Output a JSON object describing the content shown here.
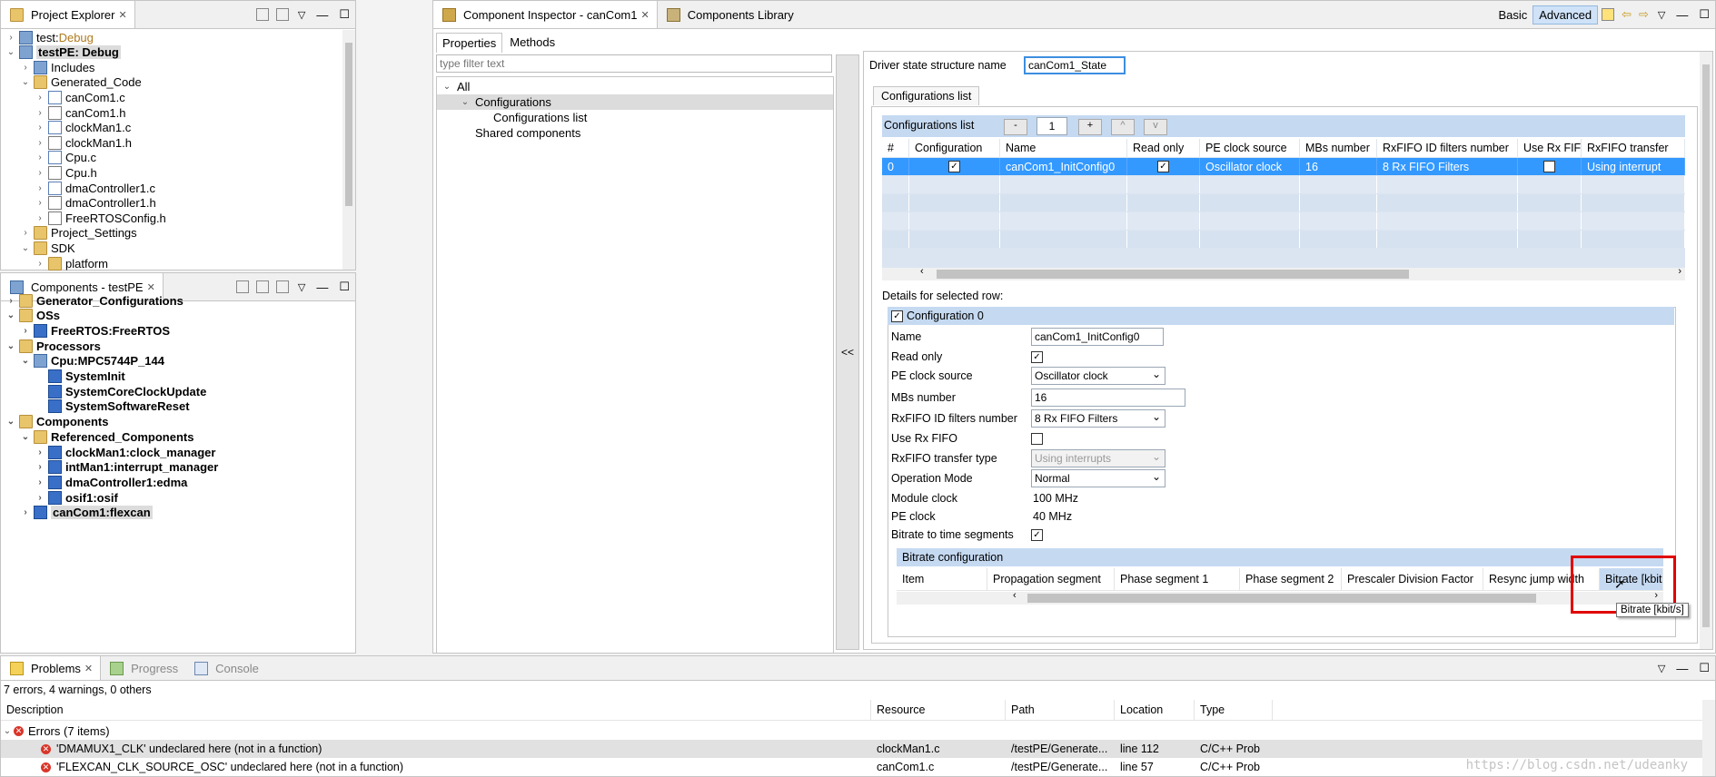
{
  "project_explorer": {
    "title": "Project Explorer",
    "items": [
      {
        "label": "test: ",
        "label2": "Debug",
        "indent": 0,
        "tw": "›",
        "icon": "project-icon",
        "bold": false
      },
      {
        "label": "testPE: Debug",
        "label2": "",
        "indent": 0,
        "tw": "⌄",
        "icon": "project-icon",
        "bold": true
      },
      {
        "label": "Includes",
        "label2": "",
        "indent": 1,
        "tw": "›",
        "icon": "includes-icon",
        "bold": false
      },
      {
        "label": "Generated_Code",
        "label2": "",
        "indent": 1,
        "tw": "⌄",
        "icon": "folder-icon",
        "bold": false
      },
      {
        "label": "canCom1.c",
        "label2": "",
        "indent": 2,
        "tw": "›",
        "icon": "c-file-icon",
        "bold": false
      },
      {
        "label": "canCom1.h",
        "label2": "",
        "indent": 2,
        "tw": "›",
        "icon": "h-file-icon",
        "bold": false
      },
      {
        "label": "clockMan1.c",
        "label2": "",
        "indent": 2,
        "tw": "›",
        "icon": "c-file-icon",
        "bold": false
      },
      {
        "label": "clockMan1.h",
        "label2": "",
        "indent": 2,
        "tw": "›",
        "icon": "h-file-icon",
        "bold": false
      },
      {
        "label": "Cpu.c",
        "label2": "",
        "indent": 2,
        "tw": "›",
        "icon": "c-file-icon",
        "bold": false
      },
      {
        "label": "Cpu.h",
        "label2": "",
        "indent": 2,
        "tw": "›",
        "icon": "h-file-icon",
        "bold": false
      },
      {
        "label": "dmaController1.c",
        "label2": "",
        "indent": 2,
        "tw": "›",
        "icon": "c-file-icon",
        "bold": false
      },
      {
        "label": "dmaController1.h",
        "label2": "",
        "indent": 2,
        "tw": "›",
        "icon": "h-file-icon",
        "bold": false
      },
      {
        "label": "FreeRTOSConfig.h",
        "label2": "",
        "indent": 2,
        "tw": "›",
        "icon": "h-file-icon",
        "bold": false
      },
      {
        "label": "Project_Settings",
        "label2": "",
        "indent": 1,
        "tw": "›",
        "icon": "folder-icon",
        "bold": false
      },
      {
        "label": "SDK",
        "label2": "",
        "indent": 1,
        "tw": "⌄",
        "icon": "folder-icon",
        "bold": false
      },
      {
        "label": "platform",
        "label2": "",
        "indent": 2,
        "tw": "›",
        "icon": "folder-icon",
        "bold": false
      }
    ]
  },
  "components_view": {
    "title": "Components - testPE",
    "items": [
      {
        "label": "Generator_Configurations",
        "indent": 0,
        "tw": "›",
        "icon": "folder-icon"
      },
      {
        "label": "OSs",
        "indent": 0,
        "tw": "⌄",
        "icon": "folder-icon"
      },
      {
        "label": "FreeRTOS:FreeRTOS",
        "indent": 1,
        "tw": "›",
        "icon": "component-icon"
      },
      {
        "label": "Processors",
        "indent": 0,
        "tw": "⌄",
        "icon": "folder-icon"
      },
      {
        "label": "Cpu:MPC5744P_144",
        "indent": 1,
        "tw": "⌄",
        "icon": "cpu-icon"
      },
      {
        "label": "SystemInit",
        "indent": 2,
        "tw": "",
        "icon": "method-icon"
      },
      {
        "label": "SystemCoreClockUpdate",
        "indent": 2,
        "tw": "",
        "icon": "method-icon"
      },
      {
        "label": "SystemSoftwareReset",
        "indent": 2,
        "tw": "",
        "icon": "method-icon"
      },
      {
        "label": "Components",
        "indent": 0,
        "tw": "⌄",
        "icon": "folder-icon"
      },
      {
        "label": "Referenced_Components",
        "indent": 1,
        "tw": "⌄",
        "icon": "folder-icon"
      },
      {
        "label": "clockMan1:clock_manager",
        "indent": 2,
        "tw": "›",
        "icon": "component-icon"
      },
      {
        "label": "intMan1:interrupt_manager",
        "indent": 2,
        "tw": "›",
        "icon": "component-icon"
      },
      {
        "label": "dmaController1:edma",
        "indent": 2,
        "tw": "›",
        "icon": "component-icon"
      },
      {
        "label": "osif1:osif",
        "indent": 2,
        "tw": "›",
        "icon": "component-icon"
      },
      {
        "label": "canCom1:flexcan",
        "indent": 1,
        "tw": "›",
        "icon": "component-icon",
        "selected": true
      }
    ]
  },
  "inspector": {
    "tab_label": "Component Inspector - canCom1",
    "library_tab": "Components Library",
    "mode_basic": "Basic",
    "mode_advanced": "Advanced",
    "subtabs": [
      "Properties",
      "Methods"
    ],
    "filter_placeholder": "type filter text",
    "tree": [
      {
        "label": "All",
        "indent": 0,
        "tw": "⌄"
      },
      {
        "label": "Configurations",
        "indent": 1,
        "tw": "⌄",
        "selected": true
      },
      {
        "label": "Configurations list",
        "indent": 2,
        "tw": ""
      },
      {
        "label": "Shared components",
        "indent": 1,
        "tw": ""
      }
    ],
    "collapse_label": "<<",
    "driver_state_label": "Driver state structure name",
    "driver_state_value": "canCom1_State",
    "config_tab": "Configurations list",
    "config_list_label": "Configurations list",
    "config_count": "1",
    "btn_minus": "-",
    "btn_plus": "+",
    "btn_up": "^",
    "btn_down": "v",
    "grid_headers": [
      "#",
      "Configuration",
      "Name",
      "Read only",
      "PE clock source",
      "MBs number",
      "RxFIFO ID filters number",
      "Use Rx FIFO",
      "RxFIFO transfer"
    ],
    "grid_row": {
      "num": "0",
      "config_checked": true,
      "name": "canCom1_InitConfig0",
      "readonly_checked": true,
      "clock": "Oscillator clock",
      "mbs": "16",
      "filters": "8 Rx FIFO Filters",
      "use_fifo_checked": false,
      "transfer": "Using interrupt"
    },
    "details_label": "Details for selected row:",
    "config0_label": "Configuration 0",
    "fields": {
      "name_label": "Name",
      "name_value": "canCom1_InitConfig0",
      "readonly_label": "Read only",
      "clock_label": "PE clock source",
      "clock_value": "Oscillator clock",
      "mbs_label": "MBs number",
      "mbs_value": "16",
      "filters_label": "RxFIFO ID filters number",
      "filters_value": "8 Rx FIFO Filters",
      "usefifo_label": "Use Rx FIFO",
      "transfer_label": "RxFIFO transfer type",
      "transfer_value": "Using interrupts",
      "opmode_label": "Operation Mode",
      "opmode_value": "Normal",
      "modclock_label": "Module clock",
      "modclock_value": "100 MHz",
      "peclock_label": "PE clock",
      "peclock_value": "40 MHz",
      "bitrate_seg_label": "Bitrate to time segments"
    },
    "bitrate_label": "Bitrate configuration",
    "bitrate_headers": [
      "Item",
      "Propagation segment",
      "Phase segment 1",
      "Phase segment 2",
      "Prescaler Division Factor",
      "Resync jump width",
      "Bitrate [kbit"
    ],
    "tooltip": "Bitrate [kbit/s]"
  },
  "problems": {
    "tabs": [
      "Problems",
      "Progress",
      "Console"
    ],
    "summary": "7 errors, 4 warnings, 0 others",
    "headers": [
      "Description",
      "Resource",
      "Path",
      "Location",
      "Type"
    ],
    "group": "Errors (7 items)",
    "rows": [
      {
        "desc": "'DMAMUX1_CLK' undeclared here (not in a function)",
        "resource": "clockMan1.c",
        "path": "/testPE/Generate...",
        "location": "line 112",
        "type": "C/C++ Prob"
      },
      {
        "desc": "'FLEXCAN_CLK_SOURCE_OSC' undeclared here (not in a function)",
        "resource": "canCom1.c",
        "path": "/testPE/Generate...",
        "location": "line 57",
        "type": "C/C++ Prob"
      }
    ],
    "watermark": "https://blog.csdn.net/udeanky"
  },
  "colors": {
    "selection": "#3399ff",
    "header_blue": "#c5d9f1",
    "highlight_red": "#e00000"
  }
}
